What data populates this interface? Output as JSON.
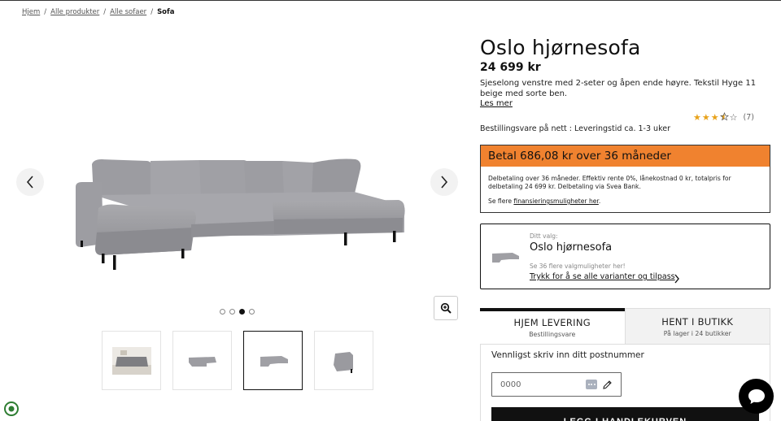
{
  "breadcrumb": {
    "items": [
      "Hjem",
      "Alle produkter",
      "Alle sofaer"
    ],
    "separator": "/",
    "current": "Sofa"
  },
  "product": {
    "title": "Oslo hjørnesofa",
    "price": "24 699 kr",
    "description": "Sjeselong venstre med 2-seter og åpen ende høyre. Tekstil Hyge 11 beige med sorte ben.",
    "read_more": "Les mer",
    "rating": 3.5,
    "rating_max": 5,
    "review_count": "(7)",
    "delivery_info": "Bestillingsvare på nett : Leveringstid ca. 1-3 uker"
  },
  "gallery": {
    "thumbnail_count": 4,
    "active_index": 2,
    "dots": 4,
    "active_dot": 2
  },
  "finance": {
    "headline": "Betal 686,08 kr over 36 måneder",
    "details": "Delbetaling over 36 måneder. Effektiv rente 0%, lånekostnad 0 kr, totalpris for delbetaling 24 699 kr. Delbetaling via Svea Bank.",
    "more_prefix": "Se flere ",
    "more_link": "finansieringsmuligheter her",
    "more_suffix": ".",
    "accent_color": "#f0822f"
  },
  "choice": {
    "label": "Ditt valg:",
    "name": "Oslo hjørnesofa",
    "more": "Se 36 flere valgmuligheter her!",
    "link": "Trykk for å se alle varianter og tilpass"
  },
  "delivery_tabs": [
    {
      "title": "HJEM LEVERING",
      "subtitle": "Bestillingsvare"
    },
    {
      "title": "HENT I BUTIKK",
      "subtitle": "På lager i 24 butikker"
    }
  ],
  "postcode": {
    "label": "Vennligst skriv inn ditt postnummer",
    "placeholder": "0000"
  },
  "cta": {
    "label": "LEGG I HANDLEKURVEN"
  },
  "icons": {
    "prev": "chevron-left-icon",
    "next": "chevron-right-icon",
    "zoom": "zoom-in-icon",
    "chat": "chat-bubble-icon",
    "edit": "pencil-icon"
  }
}
